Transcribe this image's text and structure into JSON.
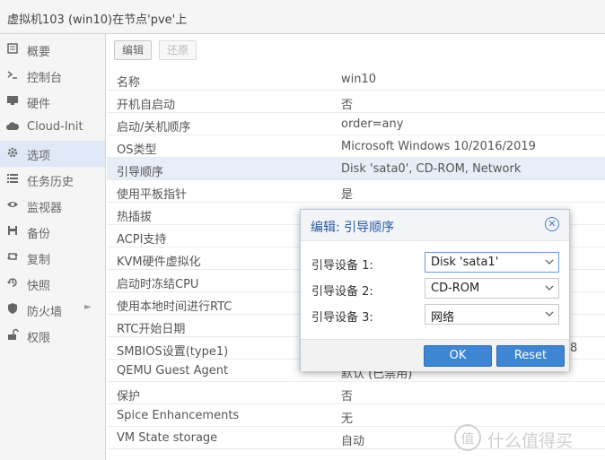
{
  "window": {
    "title": "虚拟机103 (win10)在节点'pve'上"
  },
  "sidebar": {
    "items": [
      {
        "label": "概要",
        "icon": "summary-icon"
      },
      {
        "label": "控制台",
        "icon": "console-icon"
      },
      {
        "label": "硬件",
        "icon": "monitor-icon"
      },
      {
        "label": "Cloud-Init",
        "icon": "cloud-icon"
      },
      {
        "label": "选项",
        "icon": "gear-icon"
      },
      {
        "label": "任务历史",
        "icon": "list-icon"
      },
      {
        "label": "监视器",
        "icon": "eye-icon"
      },
      {
        "label": "备份",
        "icon": "floppy-icon"
      },
      {
        "label": "复制",
        "icon": "retweet-icon"
      },
      {
        "label": "快照",
        "icon": "history-icon"
      },
      {
        "label": "防火墙",
        "icon": "shield-icon"
      },
      {
        "label": "权限",
        "icon": "unlock-icon"
      }
    ],
    "selected_label": "选项"
  },
  "toolbar": {
    "edit_label": "编辑",
    "revert_label": "还原"
  },
  "options": {
    "rows": [
      {
        "key": "名称",
        "value": "win10"
      },
      {
        "key": "开机自启动",
        "value": "否"
      },
      {
        "key": "启动/关机顺序",
        "value": "order=any"
      },
      {
        "key": "OS类型",
        "value": "Microsoft Windows 10/2016/2019"
      },
      {
        "key": "引导顺序",
        "value": "Disk 'sata0', CD-ROM, Network"
      },
      {
        "key": "使用平板指针",
        "value": "是"
      },
      {
        "key": "热插拔",
        "value": ""
      },
      {
        "key": "ACPI支持",
        "value": ""
      },
      {
        "key": "KVM硬件虚拟化",
        "value": ""
      },
      {
        "key": "启动时冻结CPU",
        "value": ""
      },
      {
        "key": "使用本地时间进行RTC",
        "value": ""
      },
      {
        "key": "RTC开始日期",
        "value": ""
      },
      {
        "key": "SMBIOS设置(type1)",
        "value": "a8"
      },
      {
        "key": "QEMU Guest Agent",
        "value": "默认 (已禁用)"
      },
      {
        "key": "保护",
        "value": "否"
      },
      {
        "key": "Spice Enhancements",
        "value": "无"
      },
      {
        "key": "VM State storage",
        "value": "自动"
      }
    ],
    "selected_key": "引导顺序"
  },
  "dialog": {
    "title": "编辑: 引导顺序",
    "fields": [
      {
        "label": "引导设备 1:",
        "value": "Disk 'sata1'"
      },
      {
        "label": "引导设备 2:",
        "value": "CD-ROM"
      },
      {
        "label": "引导设备 3:",
        "value": "网络"
      }
    ],
    "ok_label": "OK",
    "reset_label": "Reset"
  },
  "watermark": {
    "text": "什么值得买",
    "logo_glyph": "值"
  },
  "colors": {
    "accent": "#3e86d3",
    "selection": "#dfe8f6",
    "dialog_title": "#2a5aa6"
  }
}
